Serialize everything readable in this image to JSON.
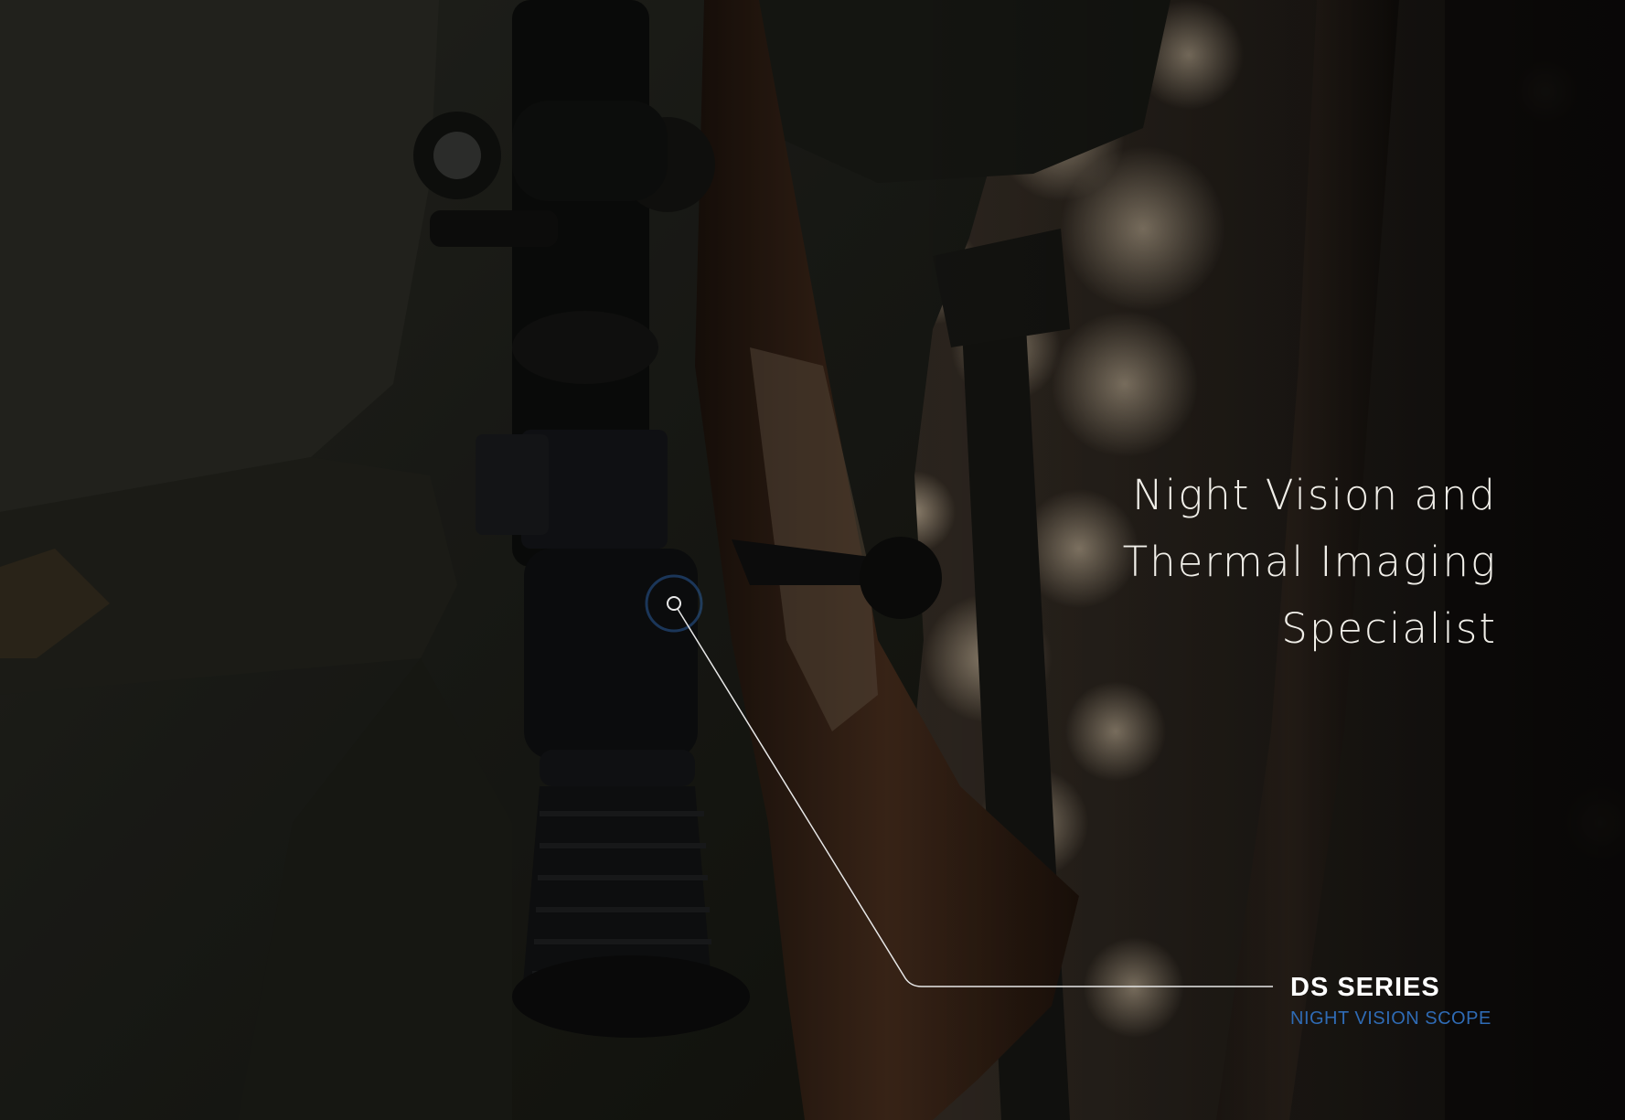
{
  "headline": {
    "line1": "Night Vision and",
    "line2": "Thermal Imaging",
    "line3": "Specialist"
  },
  "product": {
    "name": "DS SERIES",
    "type": "NIGHT VISION SCOPE"
  },
  "colors": {
    "accent": "#2f6bb5",
    "headline_text": "#f1efe9",
    "callout_line": "#e8e8e8"
  }
}
